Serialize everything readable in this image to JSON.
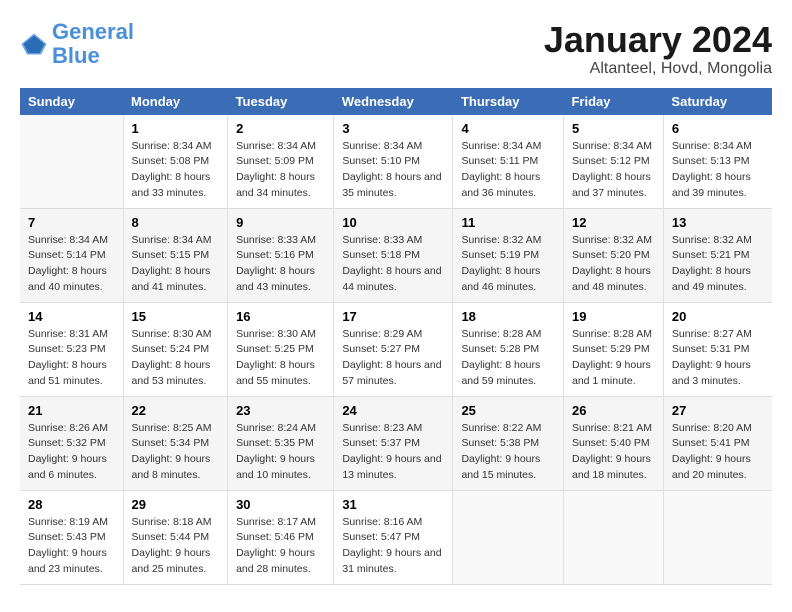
{
  "header": {
    "logo_general": "General",
    "logo_blue": "Blue",
    "main_title": "January 2024",
    "subtitle": "Altanteel, Hovd, Mongolia"
  },
  "days_of_week": [
    "Sunday",
    "Monday",
    "Tuesday",
    "Wednesday",
    "Thursday",
    "Friday",
    "Saturday"
  ],
  "weeks": [
    [
      {
        "day": "",
        "sunrise": "",
        "sunset": "",
        "daylight": ""
      },
      {
        "day": "1",
        "sunrise": "Sunrise: 8:34 AM",
        "sunset": "Sunset: 5:08 PM",
        "daylight": "Daylight: 8 hours and 33 minutes."
      },
      {
        "day": "2",
        "sunrise": "Sunrise: 8:34 AM",
        "sunset": "Sunset: 5:09 PM",
        "daylight": "Daylight: 8 hours and 34 minutes."
      },
      {
        "day": "3",
        "sunrise": "Sunrise: 8:34 AM",
        "sunset": "Sunset: 5:10 PM",
        "daylight": "Daylight: 8 hours and 35 minutes."
      },
      {
        "day": "4",
        "sunrise": "Sunrise: 8:34 AM",
        "sunset": "Sunset: 5:11 PM",
        "daylight": "Daylight: 8 hours and 36 minutes."
      },
      {
        "day": "5",
        "sunrise": "Sunrise: 8:34 AM",
        "sunset": "Sunset: 5:12 PM",
        "daylight": "Daylight: 8 hours and 37 minutes."
      },
      {
        "day": "6",
        "sunrise": "Sunrise: 8:34 AM",
        "sunset": "Sunset: 5:13 PM",
        "daylight": "Daylight: 8 hours and 39 minutes."
      }
    ],
    [
      {
        "day": "7",
        "sunrise": "Sunrise: 8:34 AM",
        "sunset": "Sunset: 5:14 PM",
        "daylight": "Daylight: 8 hours and 40 minutes."
      },
      {
        "day": "8",
        "sunrise": "Sunrise: 8:34 AM",
        "sunset": "Sunset: 5:15 PM",
        "daylight": "Daylight: 8 hours and 41 minutes."
      },
      {
        "day": "9",
        "sunrise": "Sunrise: 8:33 AM",
        "sunset": "Sunset: 5:16 PM",
        "daylight": "Daylight: 8 hours and 43 minutes."
      },
      {
        "day": "10",
        "sunrise": "Sunrise: 8:33 AM",
        "sunset": "Sunset: 5:18 PM",
        "daylight": "Daylight: 8 hours and 44 minutes."
      },
      {
        "day": "11",
        "sunrise": "Sunrise: 8:32 AM",
        "sunset": "Sunset: 5:19 PM",
        "daylight": "Daylight: 8 hours and 46 minutes."
      },
      {
        "day": "12",
        "sunrise": "Sunrise: 8:32 AM",
        "sunset": "Sunset: 5:20 PM",
        "daylight": "Daylight: 8 hours and 48 minutes."
      },
      {
        "day": "13",
        "sunrise": "Sunrise: 8:32 AM",
        "sunset": "Sunset: 5:21 PM",
        "daylight": "Daylight: 8 hours and 49 minutes."
      }
    ],
    [
      {
        "day": "14",
        "sunrise": "Sunrise: 8:31 AM",
        "sunset": "Sunset: 5:23 PM",
        "daylight": "Daylight: 8 hours and 51 minutes."
      },
      {
        "day": "15",
        "sunrise": "Sunrise: 8:30 AM",
        "sunset": "Sunset: 5:24 PM",
        "daylight": "Daylight: 8 hours and 53 minutes."
      },
      {
        "day": "16",
        "sunrise": "Sunrise: 8:30 AM",
        "sunset": "Sunset: 5:25 PM",
        "daylight": "Daylight: 8 hours and 55 minutes."
      },
      {
        "day": "17",
        "sunrise": "Sunrise: 8:29 AM",
        "sunset": "Sunset: 5:27 PM",
        "daylight": "Daylight: 8 hours and 57 minutes."
      },
      {
        "day": "18",
        "sunrise": "Sunrise: 8:28 AM",
        "sunset": "Sunset: 5:28 PM",
        "daylight": "Daylight: 8 hours and 59 minutes."
      },
      {
        "day": "19",
        "sunrise": "Sunrise: 8:28 AM",
        "sunset": "Sunset: 5:29 PM",
        "daylight": "Daylight: 9 hours and 1 minute."
      },
      {
        "day": "20",
        "sunrise": "Sunrise: 8:27 AM",
        "sunset": "Sunset: 5:31 PM",
        "daylight": "Daylight: 9 hours and 3 minutes."
      }
    ],
    [
      {
        "day": "21",
        "sunrise": "Sunrise: 8:26 AM",
        "sunset": "Sunset: 5:32 PM",
        "daylight": "Daylight: 9 hours and 6 minutes."
      },
      {
        "day": "22",
        "sunrise": "Sunrise: 8:25 AM",
        "sunset": "Sunset: 5:34 PM",
        "daylight": "Daylight: 9 hours and 8 minutes."
      },
      {
        "day": "23",
        "sunrise": "Sunrise: 8:24 AM",
        "sunset": "Sunset: 5:35 PM",
        "daylight": "Daylight: 9 hours and 10 minutes."
      },
      {
        "day": "24",
        "sunrise": "Sunrise: 8:23 AM",
        "sunset": "Sunset: 5:37 PM",
        "daylight": "Daylight: 9 hours and 13 minutes."
      },
      {
        "day": "25",
        "sunrise": "Sunrise: 8:22 AM",
        "sunset": "Sunset: 5:38 PM",
        "daylight": "Daylight: 9 hours and 15 minutes."
      },
      {
        "day": "26",
        "sunrise": "Sunrise: 8:21 AM",
        "sunset": "Sunset: 5:40 PM",
        "daylight": "Daylight: 9 hours and 18 minutes."
      },
      {
        "day": "27",
        "sunrise": "Sunrise: 8:20 AM",
        "sunset": "Sunset: 5:41 PM",
        "daylight": "Daylight: 9 hours and 20 minutes."
      }
    ],
    [
      {
        "day": "28",
        "sunrise": "Sunrise: 8:19 AM",
        "sunset": "Sunset: 5:43 PM",
        "daylight": "Daylight: 9 hours and 23 minutes."
      },
      {
        "day": "29",
        "sunrise": "Sunrise: 8:18 AM",
        "sunset": "Sunset: 5:44 PM",
        "daylight": "Daylight: 9 hours and 25 minutes."
      },
      {
        "day": "30",
        "sunrise": "Sunrise: 8:17 AM",
        "sunset": "Sunset: 5:46 PM",
        "daylight": "Daylight: 9 hours and 28 minutes."
      },
      {
        "day": "31",
        "sunrise": "Sunrise: 8:16 AM",
        "sunset": "Sunset: 5:47 PM",
        "daylight": "Daylight: 9 hours and 31 minutes."
      },
      {
        "day": "",
        "sunrise": "",
        "sunset": "",
        "daylight": ""
      },
      {
        "day": "",
        "sunrise": "",
        "sunset": "",
        "daylight": ""
      },
      {
        "day": "",
        "sunrise": "",
        "sunset": "",
        "daylight": ""
      }
    ]
  ]
}
